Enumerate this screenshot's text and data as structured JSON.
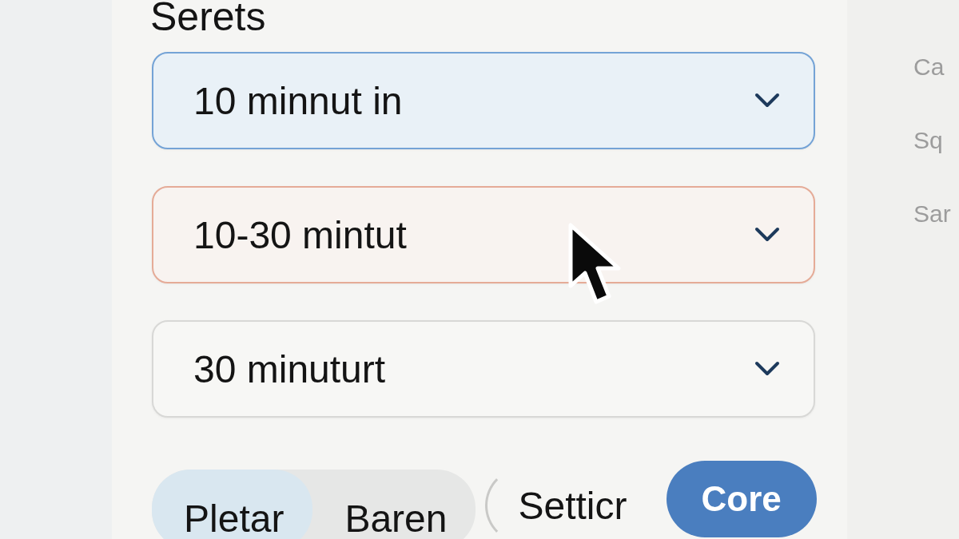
{
  "section": {
    "title": "Serets"
  },
  "dropdowns": [
    {
      "value": "10 minnut in",
      "selected": true,
      "invalid": false
    },
    {
      "value": "10-30 mintut",
      "selected": false,
      "invalid": true
    },
    {
      "value": "30 minuturt",
      "selected": false,
      "invalid": false
    }
  ],
  "segments": [
    {
      "label": "Pletar",
      "selected": true
    },
    {
      "label": "Baren",
      "selected": false
    }
  ],
  "buttons": [
    {
      "label": "Setticr",
      "kind": "outline"
    },
    {
      "label": "Core",
      "kind": "primary"
    }
  ],
  "side_panel": {
    "items": [
      "Ca",
      "Sq",
      "Sar"
    ]
  }
}
